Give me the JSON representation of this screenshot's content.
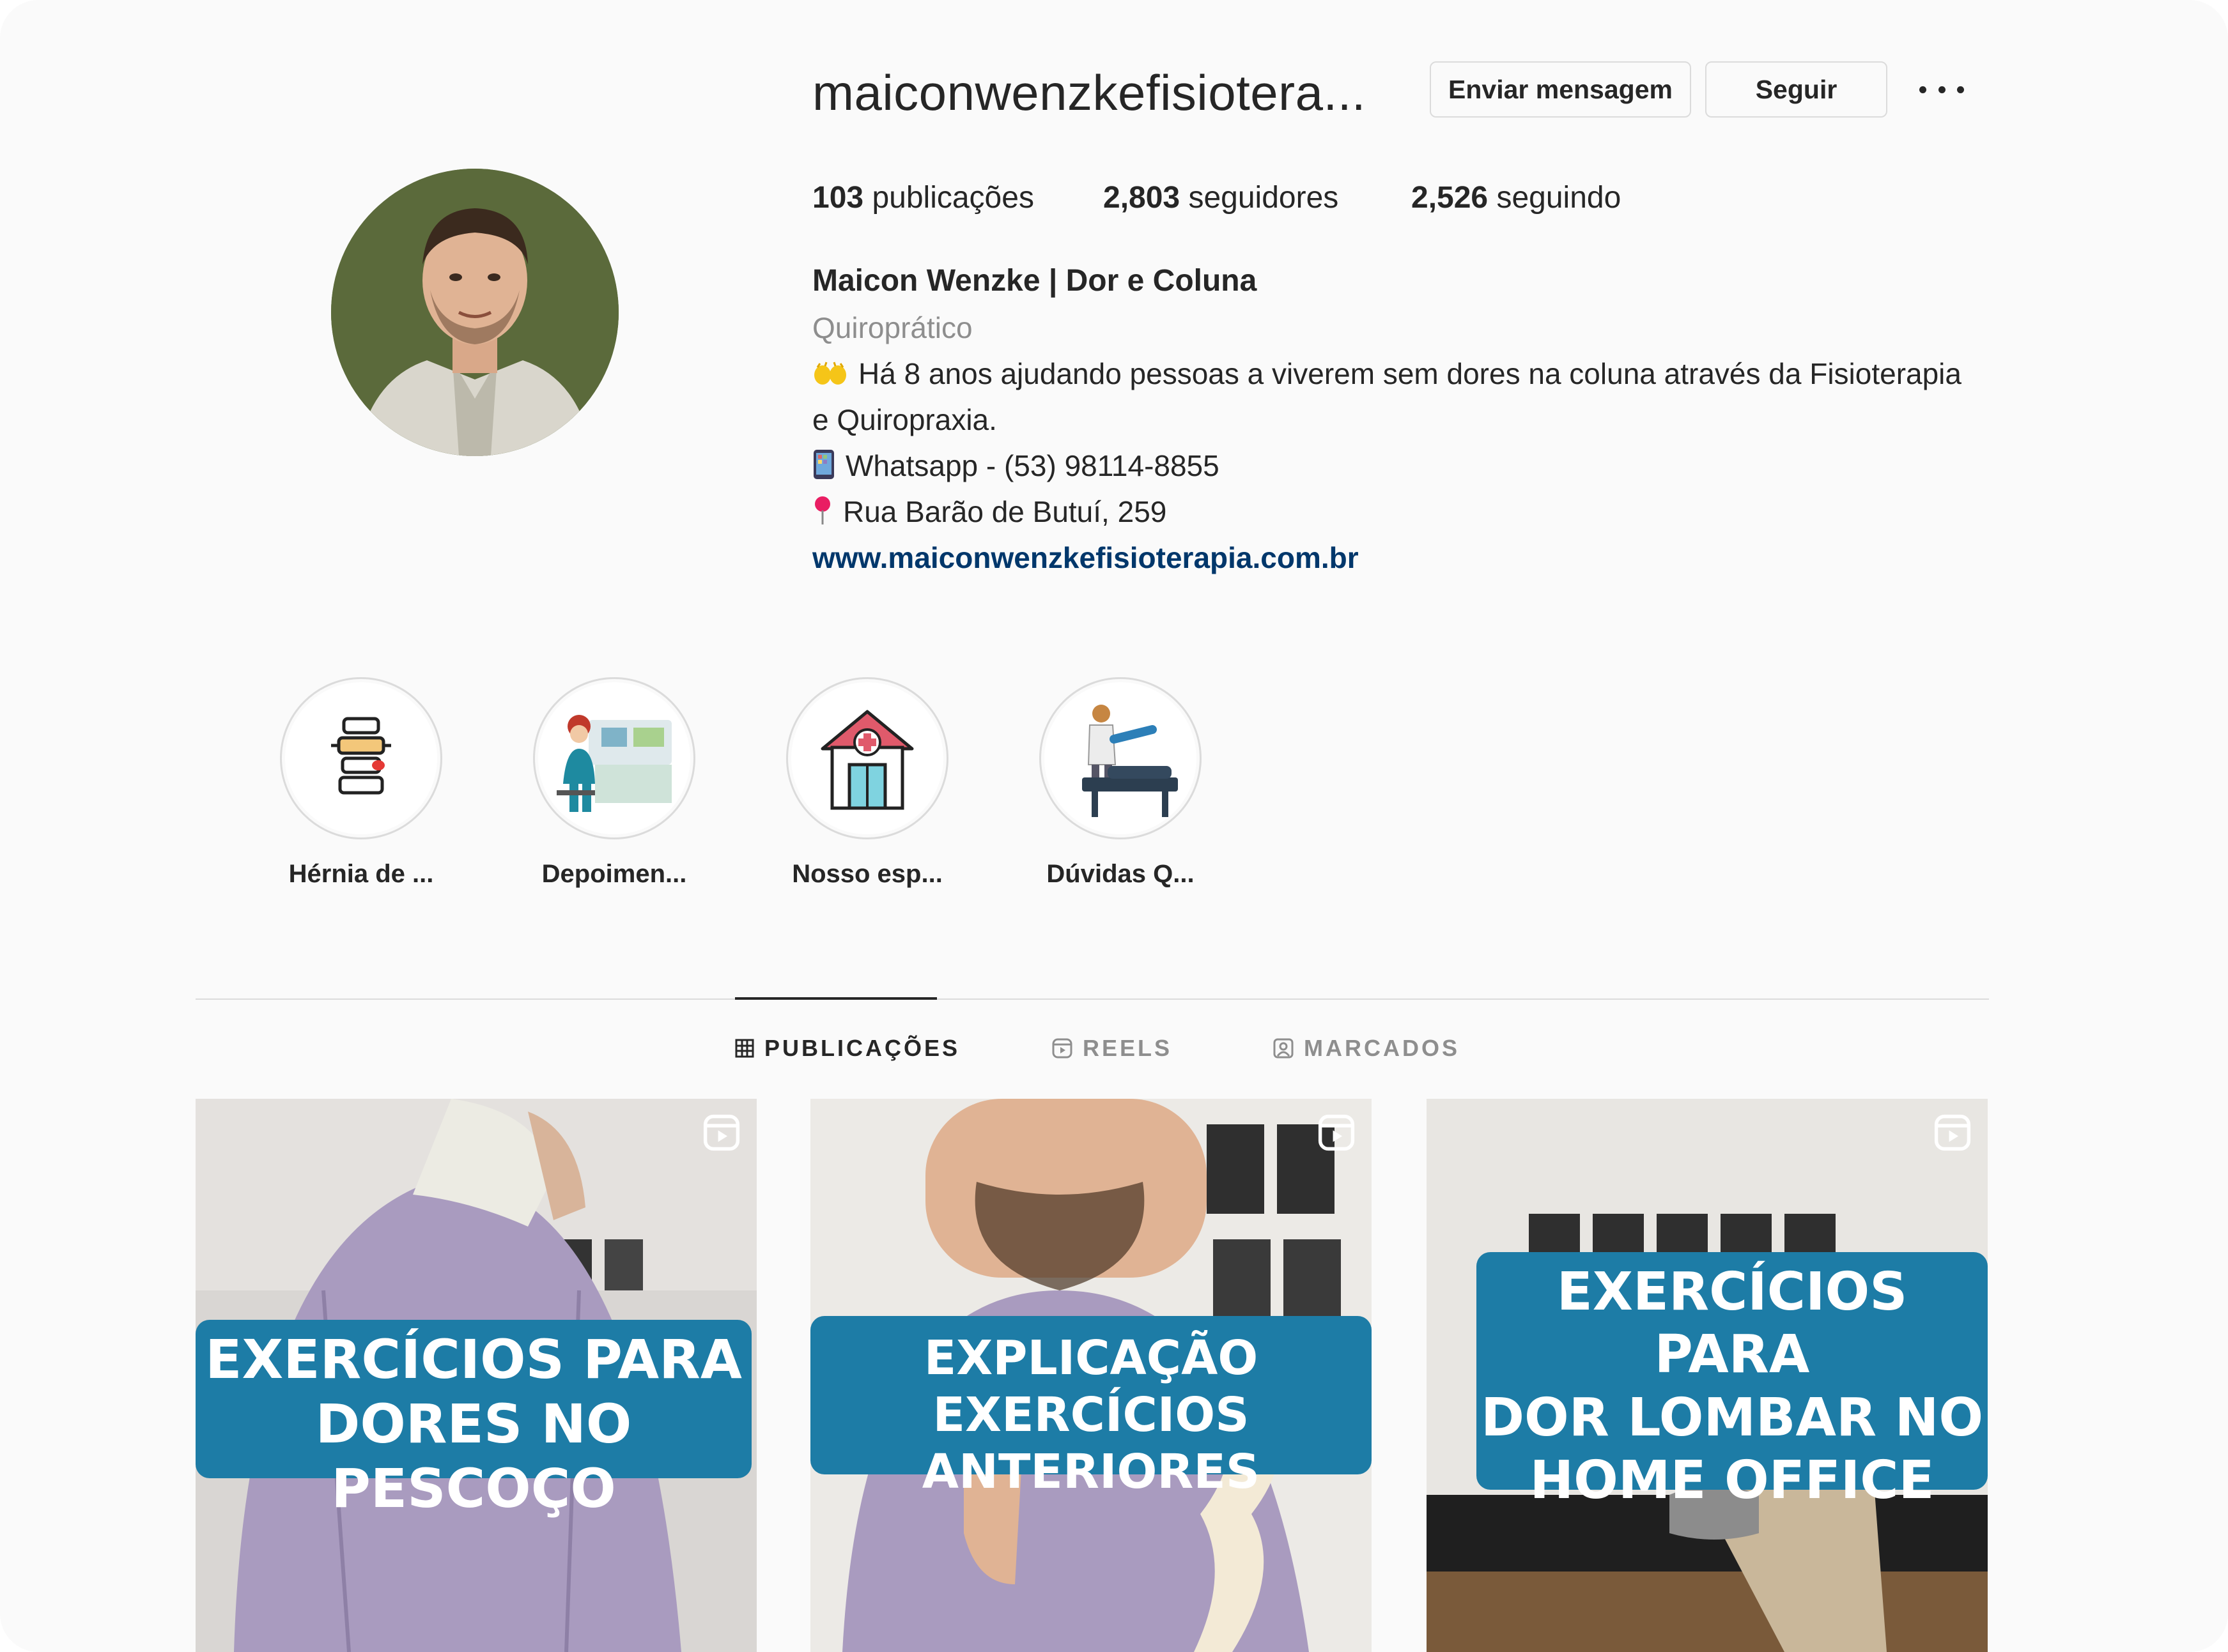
{
  "profile": {
    "username": "maiconwenzkefisiotera...",
    "message_button": "Enviar mensagem",
    "follow_button": "Seguir",
    "stats": {
      "posts_count": "103",
      "posts_label": "publicações",
      "followers_count": "2,803",
      "followers_label": "seguidores",
      "following_count": "2,526",
      "following_label": "seguindo"
    },
    "full_name": "Maicon Wenzke | Dor e Coluna",
    "category": "Quiroprático",
    "bio": {
      "line1": "Há 8 anos ajudando pessoas a viverem sem dores na coluna através da Fisioterapia",
      "line2": "e Quiropraxia.",
      "line3": "Whatsapp - (53) 98114-8855",
      "line4": "Rua Barão de Butuí, 259"
    },
    "website": "www.maiconwenzkefisioterapia.com.br"
  },
  "highlights": [
    {
      "label": "Hérnia de ...",
      "icon": "spine-icon"
    },
    {
      "label": "Depoimen...",
      "icon": "doctor-desk-icon"
    },
    {
      "label": "Nosso esp...",
      "icon": "clinic-building-icon"
    },
    {
      "label": "Dúvidas Q...",
      "icon": "treatment-table-icon"
    }
  ],
  "tabs": [
    {
      "label": "PUBLICAÇÕES",
      "icon": "grid-icon",
      "active": true
    },
    {
      "label": "REELS",
      "icon": "reels-icon",
      "active": false
    },
    {
      "label": "MARCADOS",
      "icon": "tagged-icon",
      "active": false
    }
  ],
  "posts": [
    {
      "line1": "EXERCÍCIOS PARA",
      "line2": "DORES NO PESCOÇO",
      "icon": "reels-icon"
    },
    {
      "line1": "EXPLICAÇÃO EXERCÍCIOS",
      "line2": "ANTERIORES",
      "icon": "reels-icon"
    },
    {
      "line1": "EXERCÍCIOS PARA",
      "line2": "DOR LOMBAR NO",
      "line3": "HOME OFFICE",
      "icon": "reels-icon"
    }
  ],
  "colors": {
    "background": "#fafafa",
    "link": "#00376b",
    "banner": "#1d7ca6",
    "border": "#dbdbdb",
    "muted": "#8e8e8e"
  }
}
